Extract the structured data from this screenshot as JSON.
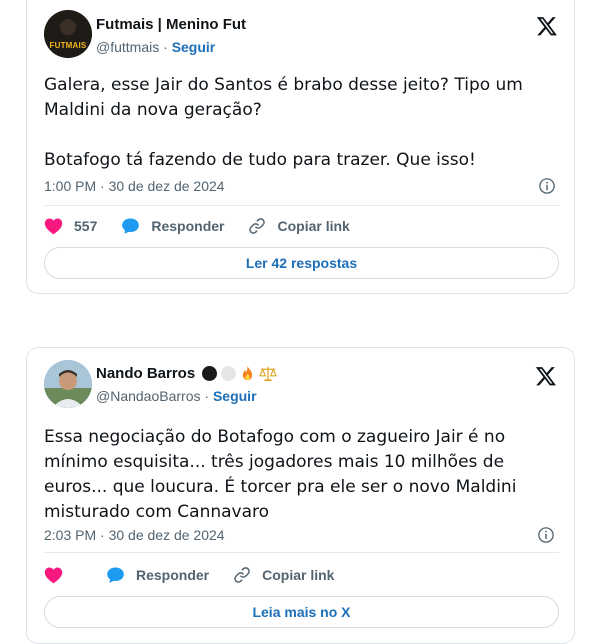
{
  "colors": {
    "link_blue": "#1d6fb8",
    "heart_pink": "#f91880",
    "reply_blue": "#1d9bf0",
    "muted_text": "#536471",
    "primary_text": "#0f1419"
  },
  "tweets": [
    {
      "author_name": "Futmais | Menino Fut",
      "handle": "@futtmais",
      "separator": "·",
      "follow_label": "Seguir",
      "avatar_icon": "futmais-logo-avatar",
      "avatar_text": "FUTMAIS",
      "text": "Galera, esse Jair do Santos é brabo desse jeito? Tipo um\nMaldini da nova geração?\n\nBotafogo tá fazendo de tudo para trazer. Que isso!",
      "timestamp": "1:00 PM · 30 de dez de 2024",
      "like_count": "557",
      "reply_label": "Responder",
      "copy_label": "Copiar link",
      "more_label": "Ler 42 respostas"
    },
    {
      "author_name": "Nando Barros",
      "name_emojis": [
        "black-circle",
        "white-circle",
        "fire",
        "balance-scale"
      ],
      "handle": "@NandaoBarros",
      "separator": "·",
      "follow_label": "Seguir",
      "avatar_icon": "person-photo-avatar",
      "text": "Essa negociação do Botafogo com o zagueiro Jair é no\nmínimo esquisita... três jogadores mais 10 milhões de\neuros... que loucura. É torcer pra ele ser o novo Maldini\nmisturado com Cannavaro",
      "timestamp": "2:03 PM · 30 de dez de 2024",
      "like_count": "",
      "reply_label": "Responder",
      "copy_label": "Copiar link",
      "more_label": "Leia mais no X"
    }
  ]
}
